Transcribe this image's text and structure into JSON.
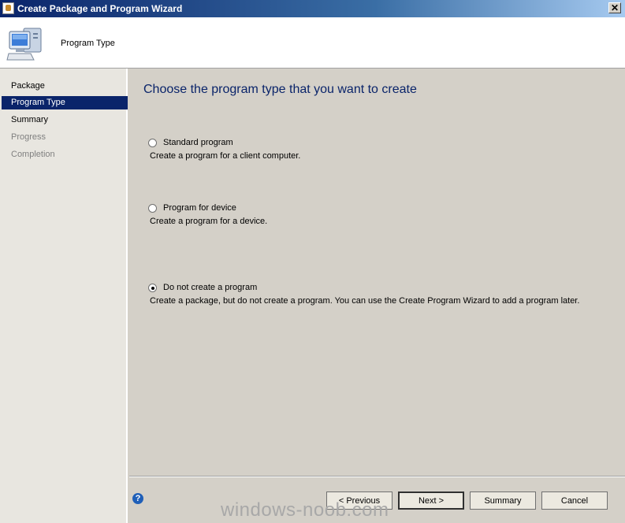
{
  "window": {
    "title": "Create Package and Program Wizard",
    "close_glyph": "✕"
  },
  "header": {
    "title": "Program Type",
    "icon": "computer-icon"
  },
  "sidebar": {
    "items": [
      {
        "label": "Package",
        "state": "normal"
      },
      {
        "label": "Program Type",
        "state": "active"
      },
      {
        "label": "Summary",
        "state": "normal"
      },
      {
        "label": "Progress",
        "state": "disabled"
      },
      {
        "label": "Completion",
        "state": "disabled"
      }
    ]
  },
  "main": {
    "heading": "Choose the program type that you want to create",
    "options": [
      {
        "label": "Standard program",
        "description": "Create a program for a client computer.",
        "checked": false
      },
      {
        "label": "Program for device",
        "description": "Create a program for a device.",
        "checked": false
      },
      {
        "label": "Do not create a program",
        "description": "Create a package, but do not create a program. You can use the Create Program Wizard to add a program later.",
        "checked": true
      }
    ]
  },
  "footer": {
    "help_glyph": "?",
    "previous_label": "< Previous",
    "next_label": "Next >",
    "summary_label": "Summary",
    "cancel_label": "Cancel"
  },
  "watermark": "windows-noob.com",
  "colors": {
    "title_bar": "#0a246a",
    "heading": "#0a246a",
    "selection": "#0a246a",
    "dialog_bg": "#d4d0c8"
  }
}
